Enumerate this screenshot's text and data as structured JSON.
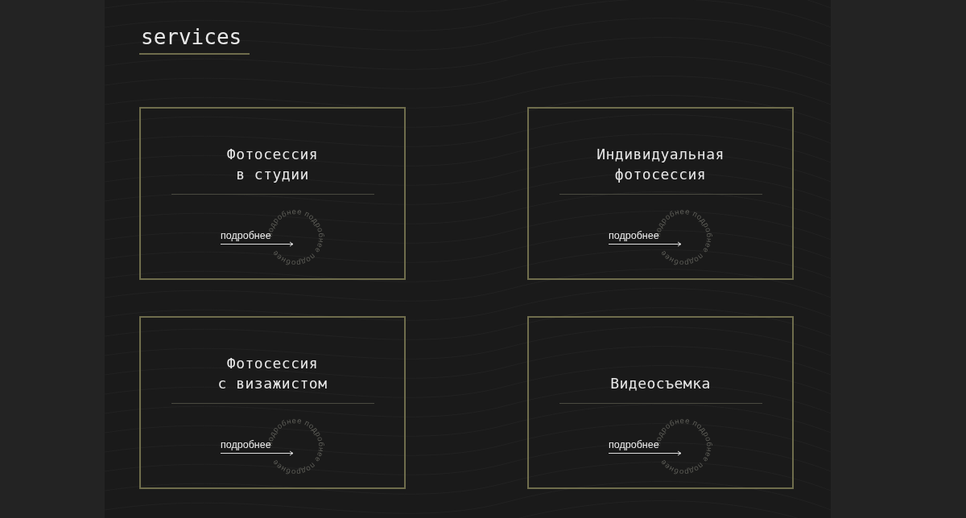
{
  "heading": "services",
  "services": [
    {
      "title_lines": [
        "Фотосессия",
        "в студии"
      ],
      "link": "подробнее",
      "ring_text": "подробнее подробнее подробнее"
    },
    {
      "title_lines": [
        "Индивидуальная",
        "фотосессия"
      ],
      "link": "подробнее",
      "ring_text": "подробнее подробнее подробнее"
    },
    {
      "title_lines": [
        "Фотосессия",
        "с визажистом"
      ],
      "link": "подробнее",
      "ring_text": "подробнее подробнее подробнее"
    },
    {
      "title_lines": [
        "Видеосъемка"
      ],
      "link": "подробнее",
      "ring_text": "подробнее подробнее подробнее"
    }
  ]
}
